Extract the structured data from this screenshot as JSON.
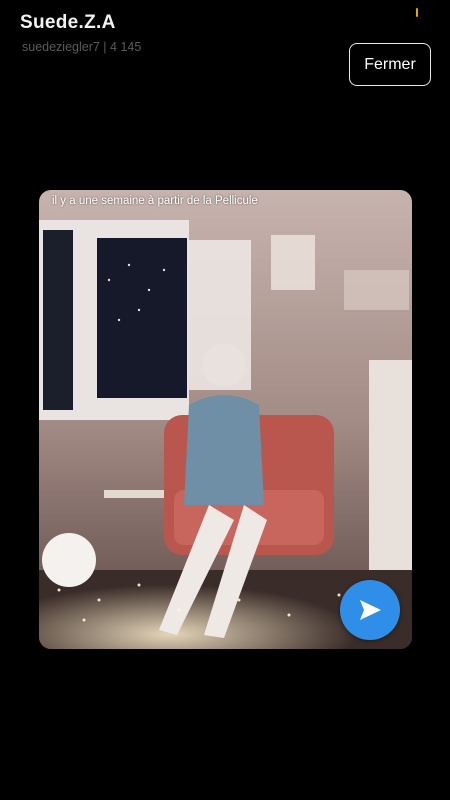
{
  "header": {
    "title": "Suede.Z.A",
    "subtitle": "suedeziegler7 | 4 145",
    "close_label": "Fermer"
  },
  "story": {
    "caption": "il y a une semaine à partir de la Pellicule",
    "image_description": "cozy-room-photo"
  },
  "actions": {
    "send_icon": "send-arrow-icon"
  },
  "colors": {
    "background": "#000000",
    "send_button": "#2f8fe8",
    "indicator": "#f0a000"
  }
}
